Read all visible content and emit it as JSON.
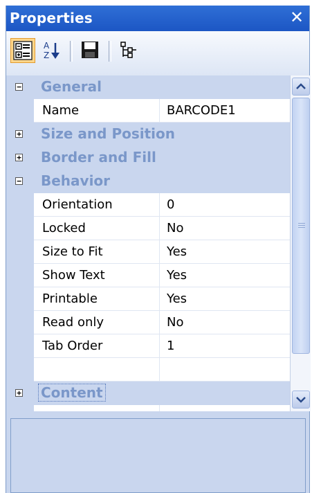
{
  "window": {
    "title": "Properties",
    "close_glyph": "✕"
  },
  "toolbar": {
    "buttons": [
      {
        "icon": "categorized-icon",
        "active": true
      },
      {
        "icon": "sort-alphabetical-icon",
        "active": false
      },
      {
        "icon": "save-icon",
        "active": false
      },
      {
        "icon": "hierarchy-icon",
        "active": false
      }
    ]
  },
  "grid": {
    "categories": {
      "general": {
        "label": "General",
        "expander": "−"
      },
      "size_position": {
        "label": "Size and Position",
        "expander": "+"
      },
      "border_fill": {
        "label": "Border and Fill",
        "expander": "+"
      },
      "behavior": {
        "label": "Behavior",
        "expander": "−"
      },
      "content": {
        "label": "Content",
        "expander": "+"
      }
    },
    "general_rows": [
      {
        "name": "Name",
        "value": "BARCODE1"
      }
    ],
    "behavior_rows": [
      {
        "name": "Orientation",
        "value": "0"
      },
      {
        "name": "Locked",
        "value": "No"
      },
      {
        "name": "Size to Fit",
        "value": "Yes"
      },
      {
        "name": "Show Text",
        "value": "Yes"
      },
      {
        "name": "Printable",
        "value": "Yes"
      },
      {
        "name": "Read only",
        "value": "No"
      },
      {
        "name": "Tab Order",
        "value": "1"
      },
      {
        "name": "",
        "value": ""
      }
    ]
  },
  "colors": {
    "title_bar": "#1c56c4",
    "category_bg": "#c9d6ee",
    "category_text": "#7a97c9",
    "active_tool": "#ffd68a"
  }
}
